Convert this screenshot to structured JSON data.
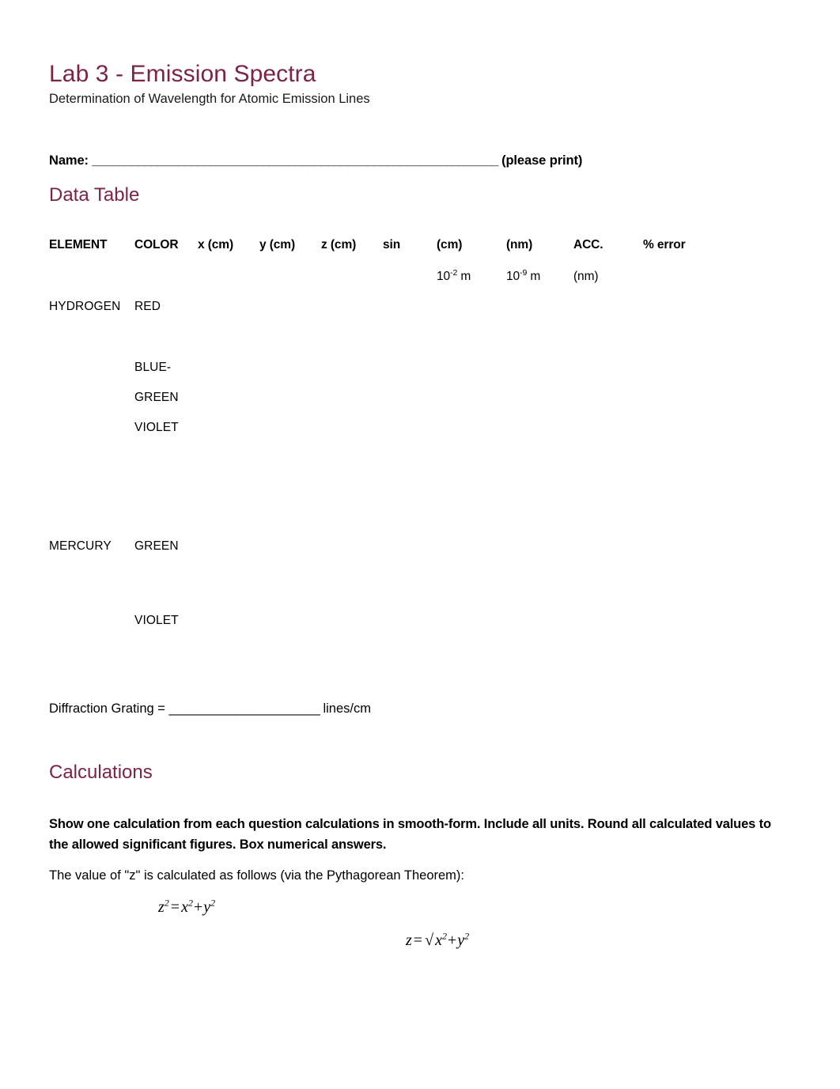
{
  "document": {
    "title": "Lab 3 - Emission Spectra",
    "subtitle": "Determination of Wavelength for Atomic Emission Lines",
    "heading_color": "#7B2349"
  },
  "name_field": {
    "label": "Name:",
    "blank": "______________________________________________________________",
    "suffix": "(please print)"
  },
  "data_table_section": {
    "heading": "Data Table",
    "headers": {
      "element": "ELEMENT",
      "color": "COLOR",
      "x": "x (cm)",
      "y": "y (cm)",
      "z": "z (cm)",
      "sin": "sin",
      "cm": "(cm)",
      "nm": "(nm)",
      "acc": "ACC.",
      "error": "% error"
    },
    "sub_headers": {
      "cm_base": "10",
      "cm_exp": "-2",
      "cm_unit": " m",
      "nm_base": "10",
      "nm_exp": "-9",
      "nm_unit": " m",
      "acc_unit": "(nm)"
    },
    "rows": [
      {
        "element": "HYDROGEN",
        "color": "RED"
      },
      {
        "element": "",
        "color": "BLUE-"
      },
      {
        "element": "",
        "color": "GREEN"
      },
      {
        "element": "",
        "color": "VIOLET"
      },
      {
        "element": "MERCURY",
        "color": "GREEN"
      },
      {
        "element": "",
        "color": "VIOLET"
      }
    ]
  },
  "grating": {
    "label": "Diffraction Grating = ",
    "blank": "_______________________",
    "unit": " lines/cm"
  },
  "calculations_section": {
    "heading": "Calculations",
    "instructions": "Show one calculation from each question calculations in smooth-form.  Include all units.  Round all calculated values to the allowed significant figures.  Box numerical answers.",
    "z_intro": "The value of \"z\" is calculated as follows (via the Pythagorean Theorem):",
    "formula_1": {
      "lhs_var": "z",
      "lhs_exp": "2",
      "equals": "=",
      "term1_var": "x",
      "term1_exp": "2",
      "plus": "+",
      "term2_var": "y",
      "term2_exp": "2"
    },
    "formula_2": {
      "lhs_var": "z",
      "equals": "=",
      "radical": "√",
      "term1_var": "x",
      "term1_exp": "2",
      "plus": "+",
      "term2_var": "y",
      "term2_exp": "2"
    }
  }
}
